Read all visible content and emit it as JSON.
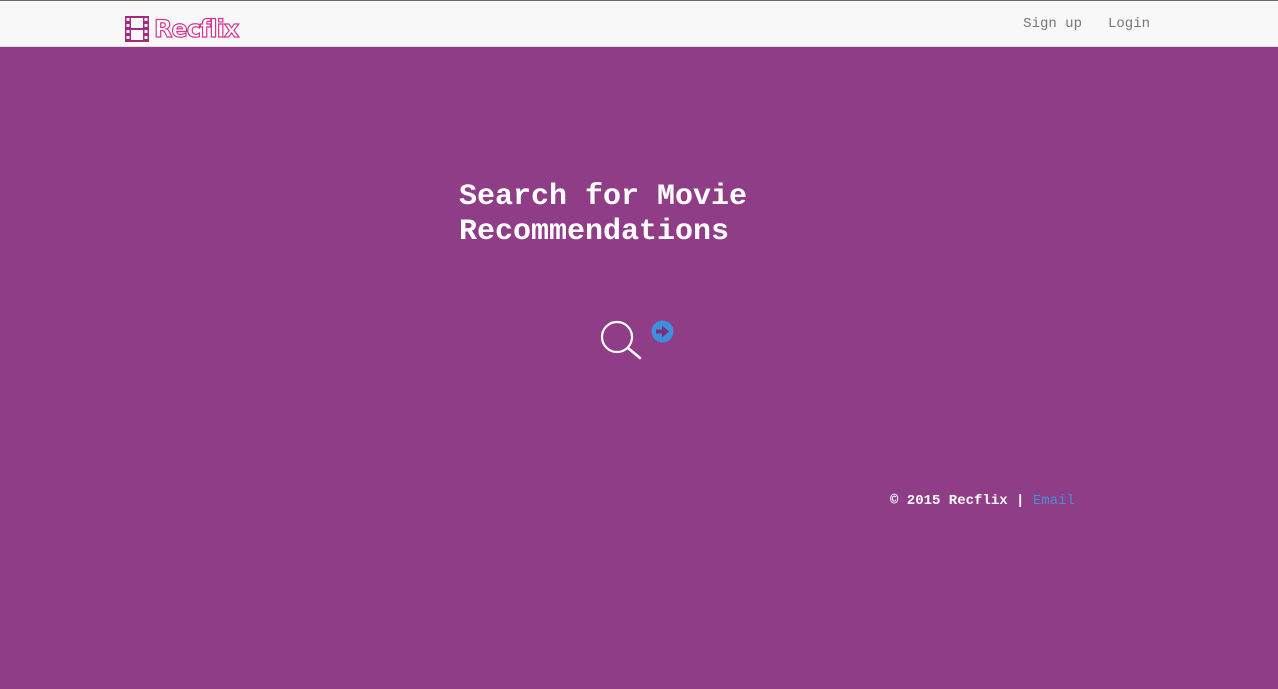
{
  "navbar": {
    "brand": "Recflix",
    "brand_icon": "film-icon",
    "links": [
      "Sign up",
      "Login"
    ]
  },
  "hero": {
    "title": "Search for Movie Recommendations"
  },
  "search": {
    "search_icon": "search-icon",
    "go_icon": "arrow-right-circle-icon"
  },
  "footer": {
    "copyright": "© 2015 Recflix",
    "separator": "|",
    "email_link": "Email"
  },
  "colors": {
    "background": "#8f3d87",
    "navbar": "#f8f8f8",
    "brand": "#d6338f",
    "link": "#4a8fd6",
    "go_button": "#3f8fdc"
  }
}
